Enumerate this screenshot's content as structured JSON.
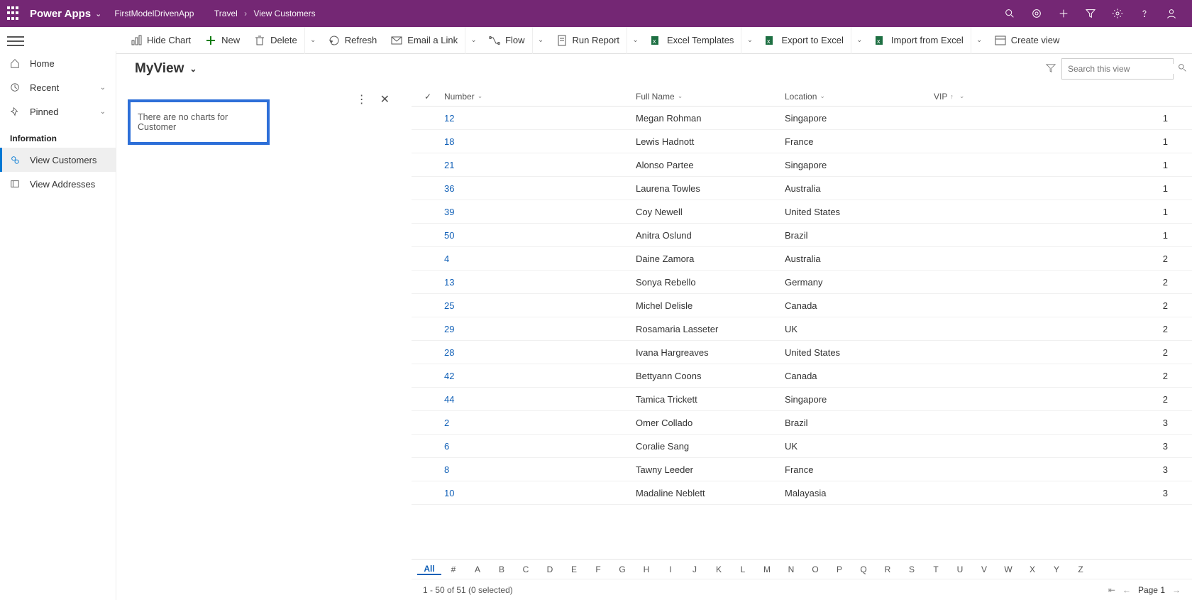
{
  "header": {
    "brand": "Power Apps",
    "app_name": "FirstModelDrivenApp",
    "crumb1": "Travel",
    "crumb2": "View Customers"
  },
  "commands": {
    "hide_chart": "Hide Chart",
    "new": "New",
    "delete": "Delete",
    "refresh": "Refresh",
    "email": "Email a Link",
    "flow": "Flow",
    "run_report": "Run Report",
    "excel_tpl": "Excel Templates",
    "export": "Export to Excel",
    "import": "Import from Excel",
    "create_view": "Create view"
  },
  "nav": {
    "home": "Home",
    "recent": "Recent",
    "pinned": "Pinned",
    "group": "Information",
    "view_customers": "View Customers",
    "view_addresses": "View Addresses"
  },
  "view": {
    "name": "MyView",
    "search_placeholder": "Search this view"
  },
  "chart_pane": {
    "empty_msg": "There are no charts for Customer"
  },
  "grid_headers": {
    "number": "Number",
    "full_name": "Full Name",
    "location": "Location",
    "vip": "VIP"
  },
  "rows": [
    {
      "num": "12",
      "name": "Megan Rohman",
      "loc": "Singapore",
      "vip": "1"
    },
    {
      "num": "18",
      "name": "Lewis Hadnott",
      "loc": "France",
      "vip": "1"
    },
    {
      "num": "21",
      "name": "Alonso Partee",
      "loc": "Singapore",
      "vip": "1"
    },
    {
      "num": "36",
      "name": "Laurena Towles",
      "loc": "Australia",
      "vip": "1"
    },
    {
      "num": "39",
      "name": "Coy Newell",
      "loc": "United States",
      "vip": "1"
    },
    {
      "num": "50",
      "name": "Anitra Oslund",
      "loc": "Brazil",
      "vip": "1"
    },
    {
      "num": "4",
      "name": "Daine Zamora",
      "loc": "Australia",
      "vip": "2"
    },
    {
      "num": "13",
      "name": "Sonya Rebello",
      "loc": "Germany",
      "vip": "2"
    },
    {
      "num": "25",
      "name": "Michel Delisle",
      "loc": "Canada",
      "vip": "2"
    },
    {
      "num": "29",
      "name": "Rosamaria Lasseter",
      "loc": "UK",
      "vip": "2"
    },
    {
      "num": "28",
      "name": "Ivana Hargreaves",
      "loc": "United States",
      "vip": "2"
    },
    {
      "num": "42",
      "name": "Bettyann Coons",
      "loc": "Canada",
      "vip": "2"
    },
    {
      "num": "44",
      "name": "Tamica Trickett",
      "loc": "Singapore",
      "vip": "2"
    },
    {
      "num": "2",
      "name": "Omer Collado",
      "loc": "Brazil",
      "vip": "3"
    },
    {
      "num": "6",
      "name": "Coralie Sang",
      "loc": "UK",
      "vip": "3"
    },
    {
      "num": "8",
      "name": "Tawny Leeder",
      "loc": "France",
      "vip": "3"
    },
    {
      "num": "10",
      "name": "Madaline Neblett",
      "loc": "Malayasia",
      "vip": "3"
    }
  ],
  "alpha_all": "All",
  "alpha_hash": "#",
  "footer": {
    "status": "1 - 50 of 51 (0 selected)",
    "page": "Page 1"
  }
}
